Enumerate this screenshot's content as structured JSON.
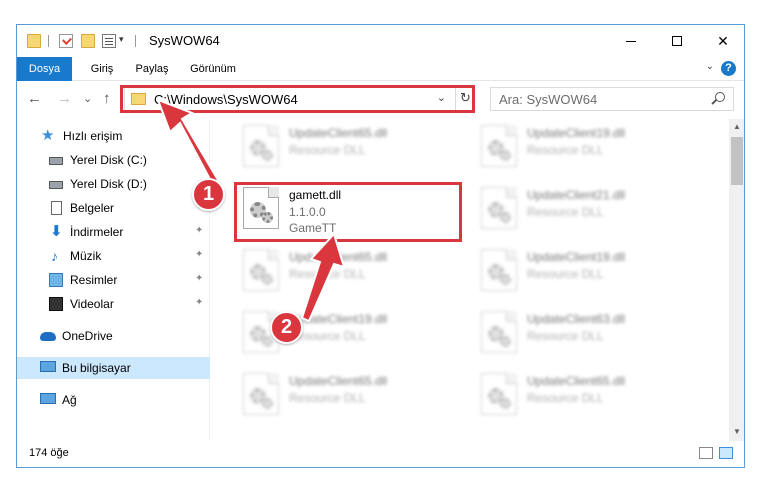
{
  "window": {
    "title": "SysWOW64",
    "minimize_glyph": "",
    "close_glyph": "✕"
  },
  "ribbon": {
    "tabs": [
      "Dosya",
      "Giriş",
      "Paylaş",
      "Görünüm"
    ],
    "help_glyph": "?"
  },
  "nav": {
    "back_glyph": "←",
    "forward_glyph": "→",
    "recent_glyph": "⌄",
    "up_glyph": "↑",
    "address": "C:\\Windows\\SysWOW64",
    "address_dropdown_glyph": "⌄",
    "refresh_glyph": "↻",
    "search_placeholder": "Ara: SysWOW64"
  },
  "sidebar": {
    "quick_access": "Hızlı erişim",
    "items": [
      {
        "label": "Yerel Disk (C:)",
        "icon": "disk-icon"
      },
      {
        "label": "Yerel Disk (D:)",
        "icon": "disk-icon"
      },
      {
        "label": "Belgeler",
        "icon": "documents-icon"
      },
      {
        "label": "İndirmeler",
        "icon": "downloads-icon"
      },
      {
        "label": "Müzik",
        "icon": "music-icon"
      },
      {
        "label": "Resimler",
        "icon": "pictures-icon"
      },
      {
        "label": "Videolar",
        "icon": "videos-icon"
      }
    ],
    "onedrive": "OneDrive",
    "this_pc": "Bu bilgisayar",
    "network": "Ağ",
    "pin_glyph": "📌"
  },
  "files": {
    "left_column": [
      {
        "name": "UpdateClient65.dll",
        "l2": "Resource DLL",
        "l3": ""
      },
      {
        "name": "gamett.dll",
        "l2": "1.1.0.0",
        "l3": "GameTT"
      },
      {
        "name": "UpdateClient65.dll",
        "l2": "Resource DLL",
        "l3": ""
      },
      {
        "name": "UpdateClient19.dll",
        "l2": "Resource DLL",
        "l3": ""
      },
      {
        "name": "UpdateClient65.dll",
        "l2": "Resource DLL",
        "l3": ""
      }
    ],
    "right_column": [
      {
        "name": "UpdateClient19.dll",
        "l2": "Resource DLL"
      },
      {
        "name": "UpdateClient21.dll",
        "l2": "Resource DLL"
      },
      {
        "name": "UpdateClient19.dll",
        "l2": "Resource DLL"
      },
      {
        "name": "UpdateClient63.dll",
        "l2": "Resource DLL"
      },
      {
        "name": "UpdateClient65.dll",
        "l2": "Resource DLL"
      }
    ]
  },
  "status": {
    "count": "174 öğe"
  },
  "steps": {
    "one": "1",
    "two": "2"
  },
  "colors": {
    "accent": "#1979ca",
    "highlight": "#d9363e",
    "selection": "#cce8ff"
  }
}
